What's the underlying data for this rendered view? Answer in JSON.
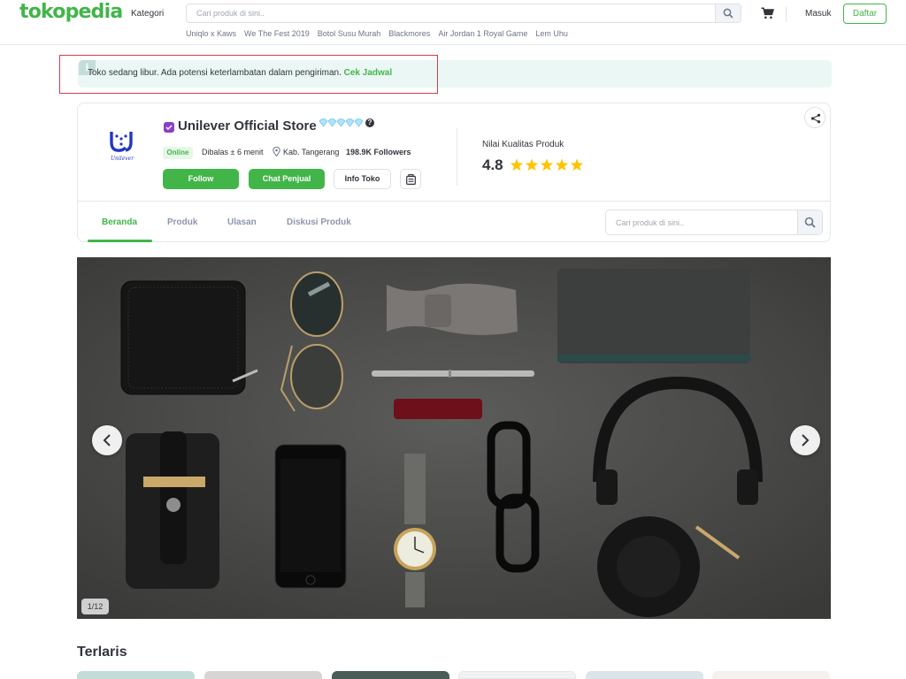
{
  "header": {
    "logo": "tokopedia",
    "kategori": "Kategori",
    "search_placeholder": "Cari produk di sini..",
    "quick_links": [
      "Uniqlo x Kaws",
      "We The Fest 2019",
      "Botol Susu Murah",
      "Blackmores",
      "Air Jordan 1 Royal Game",
      "Lem Uhu"
    ],
    "login": "Masuk",
    "register": "Daftar"
  },
  "notice": {
    "text": "Toko sedang libur. Ada potensi keterlambatan dalam pengiriman.",
    "link": "Cek Jadwal"
  },
  "shop": {
    "logo_text": "Unilever",
    "name": "Unilever Official Store",
    "status": "Online",
    "reply_time": "Dibalas ± 6 menit",
    "location": "Kab. Tangerang",
    "followers": "198.9K Followers",
    "follow_label": "Follow",
    "chat_label": "Chat Penjual",
    "info_label": "Info Toko",
    "quality_label": "Nilai Kualitas Produk",
    "rating": "4.8",
    "star_count": 5
  },
  "tabs": [
    "Beranda",
    "Produk",
    "Ulasan",
    "Diskusi Produk"
  ],
  "shop_search_placeholder": "Cari produk di sini..",
  "banner": {
    "counter": "1/12"
  },
  "section": {
    "title": "Terlaris"
  },
  "colors": {
    "brand_green": "#42b549",
    "notice_bg": "#ebf7f5",
    "highlight_red": "#d43c4d",
    "power_merchant": "#8c3fc6",
    "star": "#ffc400"
  }
}
